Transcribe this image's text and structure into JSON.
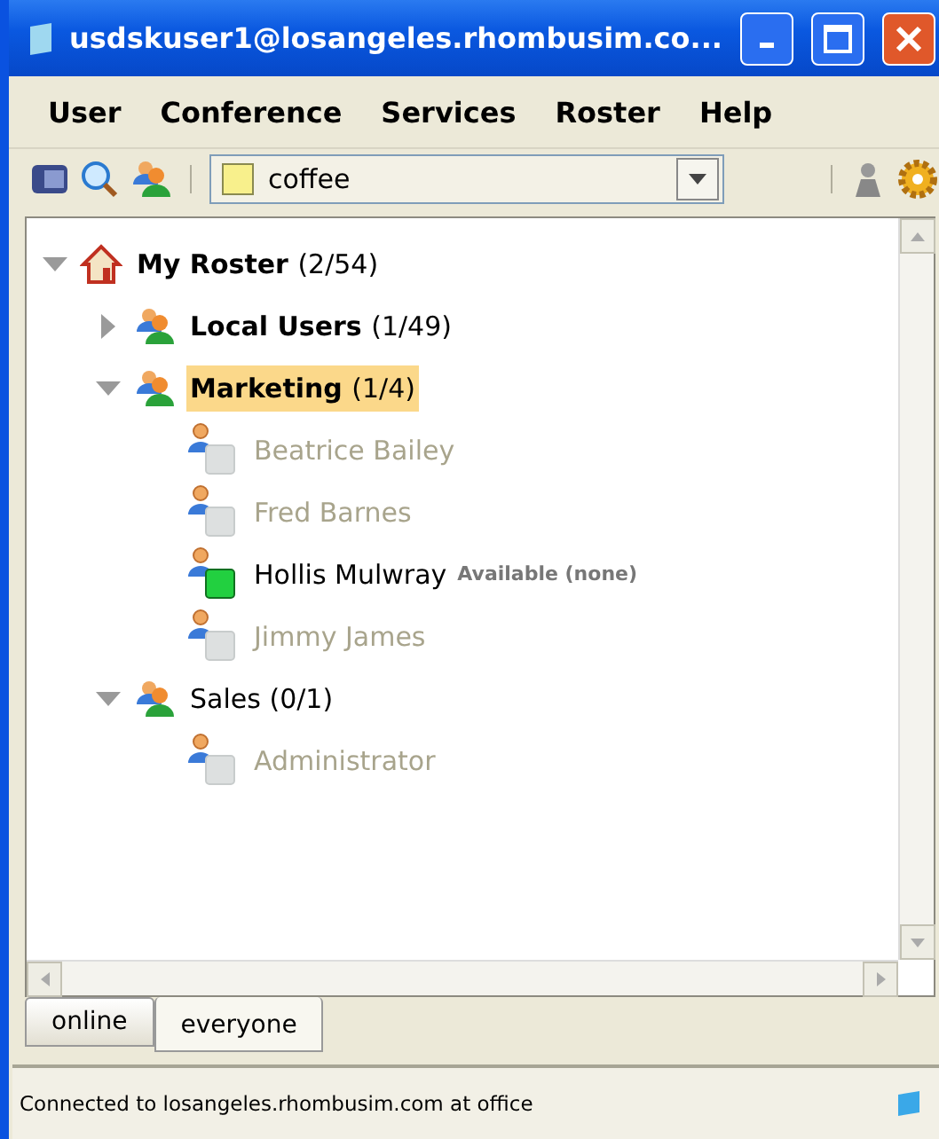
{
  "window": {
    "title": "usdskuser1@losangeles.rhombusim.co..."
  },
  "menu": [
    "User",
    "Conference",
    "Services",
    "Roster",
    "Help"
  ],
  "status_selector": {
    "value": "coffee"
  },
  "roster": {
    "label": "My Roster",
    "count": "(2/54)",
    "kind": "root",
    "expanded": true,
    "selected": false,
    "bold": true,
    "children": [
      {
        "label": "Local Users",
        "count": "(1/49)",
        "kind": "group",
        "expanded": false,
        "selected": false,
        "bold": true
      },
      {
        "label": "Marketing",
        "count": "(1/4)",
        "kind": "group",
        "expanded": true,
        "selected": true,
        "bold": true,
        "children": [
          {
            "label": "Beatrice Bailey",
            "kind": "contact",
            "online": false
          },
          {
            "label": "Fred Barnes",
            "kind": "contact",
            "online": false
          },
          {
            "label": "Hollis Mulwray",
            "kind": "contact",
            "online": true,
            "status": "Available (none)"
          },
          {
            "label": "Jimmy James",
            "kind": "contact",
            "online": false
          }
        ]
      },
      {
        "label": "Sales",
        "count": "(0/1)",
        "kind": "group",
        "expanded": true,
        "selected": false,
        "bold": false,
        "children": [
          {
            "label": "Administrator",
            "kind": "contact",
            "online": false
          }
        ]
      }
    ]
  },
  "tabs": [
    {
      "label": "online",
      "selected": false
    },
    {
      "label": "everyone",
      "selected": true
    }
  ],
  "status_bar": "Connected to losangeles.rhombusim.com at office"
}
